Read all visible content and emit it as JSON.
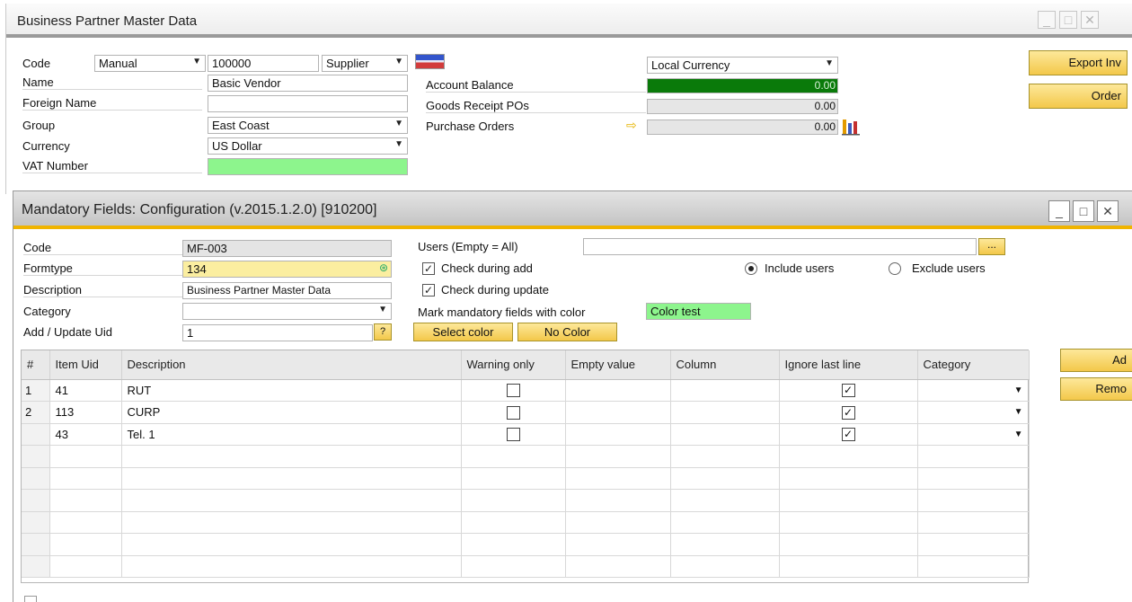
{
  "bp": {
    "title": "Business Partner Master Data",
    "code_label": "Code",
    "code_series": "Manual",
    "code_value": "100000",
    "type_value": "Supplier",
    "name_label": "Name",
    "name_value": "Basic Vendor",
    "foreign_name_label": "Foreign Name",
    "foreign_name_value": "",
    "group_label": "Group",
    "group_value": "East Coast",
    "currency_label": "Currency",
    "currency_value": "US Dollar",
    "vat_label": "VAT Number",
    "vat_value": "",
    "local_currency_select": "Local Currency",
    "account_balance_label": "Account Balance",
    "account_balance_value": "0.00",
    "goods_receipt_label": "Goods Receipt POs",
    "goods_receipt_value": "0.00",
    "purchase_orders_label": "Purchase Orders",
    "purchase_orders_value": "0.00",
    "export_button": "Export Inv",
    "order_button": "Order"
  },
  "mf": {
    "title": "Mandatory Fields: Configuration (v.2015.1.2.0) [910200]",
    "code_label": "Code",
    "code_value": "MF-003",
    "formtype_label": "Formtype",
    "formtype_value": "134",
    "description_label": "Description",
    "description_value": "Business Partner Master Data",
    "category_label": "Category",
    "category_value": "",
    "add_update_label": "Add / Update Uid",
    "add_update_value": "1",
    "help_button": "?",
    "users_label": "Users (Empty = All)",
    "users_value": "",
    "browse_button": "...",
    "check_add_label": "Check during add",
    "check_update_label": "Check during update",
    "include_users_label": "Include users",
    "exclude_users_label": "Exclude users",
    "mark_color_label": "Mark mandatory fields with color",
    "color_test_label": "Color test",
    "select_color_button": "Select color",
    "no_color_button": "No Color",
    "add_button": "Ad",
    "remove_button": "Remo",
    "columns": [
      "#",
      "Item Uid",
      "Description",
      "Warning only",
      "Empty value",
      "Column",
      "Ignore last line",
      "Category"
    ],
    "rows": [
      {
        "num": "1",
        "uid": "41",
        "desc": "RUT"
      },
      {
        "num": "2",
        "uid": "113",
        "desc": "CURP"
      },
      {
        "num": "",
        "uid": "43",
        "desc": "Tel. 1"
      }
    ]
  },
  "colors": {
    "accent_yellow": "#f0b400",
    "green_field": "#8df58d",
    "balance_green": "#0a7a0a"
  }
}
